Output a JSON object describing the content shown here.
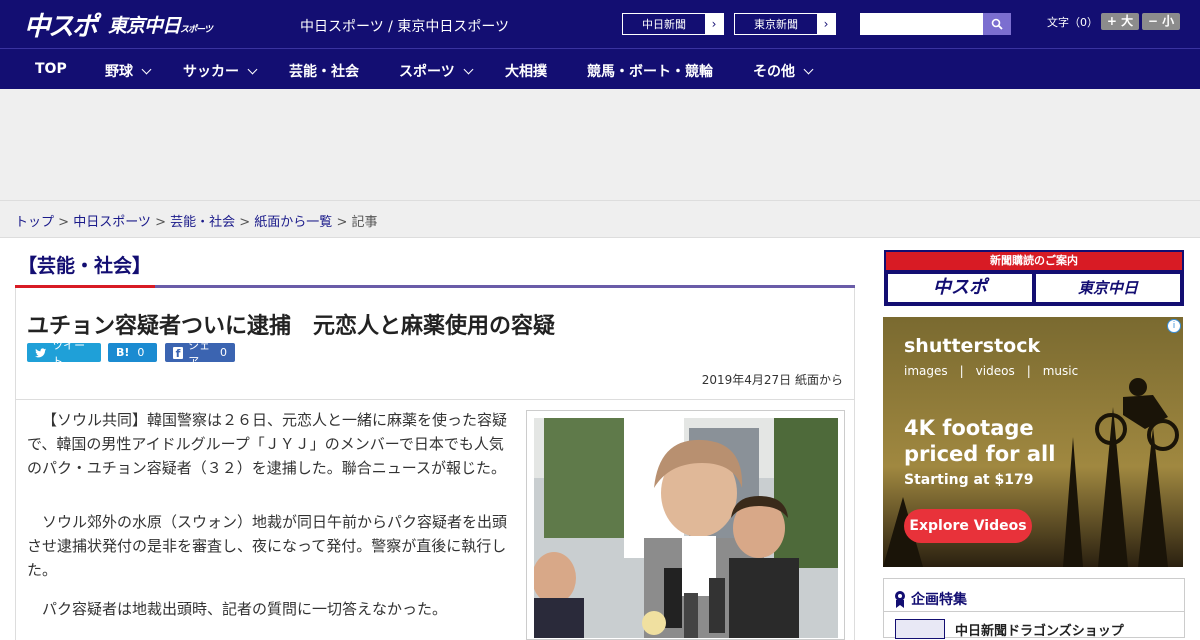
{
  "header": {
    "logo_main": "中スポ",
    "logo_tokyo": "東京中日",
    "logo_tokyo_sub": "スポーツ",
    "site_name": "中日スポーツ / 東京中日スポーツ",
    "ext_links": [
      "中日新聞",
      "東京新聞"
    ],
    "search_placeholder": "",
    "fontsize_label": "文字（0）",
    "fontsize_up": "+ 大",
    "fontsize_down": "− 小"
  },
  "nav": [
    {
      "label": "TOP",
      "dropdown": false
    },
    {
      "label": "野球",
      "dropdown": true
    },
    {
      "label": "サッカー",
      "dropdown": true
    },
    {
      "label": "芸能・社会",
      "dropdown": false
    },
    {
      "label": "スポーツ",
      "dropdown": true
    },
    {
      "label": "大相撲",
      "dropdown": false
    },
    {
      "label": "競馬・ボート・競輪",
      "dropdown": false
    },
    {
      "label": "その他",
      "dropdown": true
    }
  ],
  "breadcrumb": {
    "items": [
      "トップ",
      "中日スポーツ",
      "芸能・社会",
      "紙面から一覧"
    ],
    "sep": " > ",
    "current": "記事"
  },
  "article": {
    "category": "【芸能・社会】",
    "headline": "ユチョン容疑者ついに逮捕　元恋人と麻薬使用の容疑",
    "share_tweet": "ツイート",
    "share_hatena": "B!",
    "share_hatena_count": "0",
    "share_facebook": "シェア",
    "share_facebook_count": "0",
    "date": "2019年4月27日 紙面から",
    "paragraphs": [
      "【ソウル共同】韓国警察は２６日、元恋人と一緒に麻薬を使った容疑で、韓国の男性アイドルグループ「ＪＹＪ」のメンバーで日本でも人気のパク・ユチョン容疑者（３２）を逮捕した。聯合ニュースが報じた。",
      "ソウル郊外の水原（スウォン）地裁が同日午前からパク容疑者を出頭させ逮捕状発付の是非を審査し、夜になって発付。警察が直後に執行した。",
      "パク容疑者は地裁出頭時、記者の質問に一切答えなかった。"
    ]
  },
  "sidebar": {
    "subscribe_title": "新聞購読のご案内",
    "subscribe_logos": [
      "中スポ",
      "東京中日"
    ],
    "ad": {
      "brand": "shutterstock",
      "sub": "images　|　videos　|　music",
      "headline": "4K footage priced for all",
      "price": "Starting at $179",
      "cta": "Explore Videos",
      "info": "i"
    },
    "feature_title": "企画特集",
    "feature_item": "中日新聞ドラゴンズショップ"
  },
  "colors": {
    "brand_navy": "#130e72",
    "accent_red": "#d81b24",
    "ad_cta": "#e8323a"
  }
}
